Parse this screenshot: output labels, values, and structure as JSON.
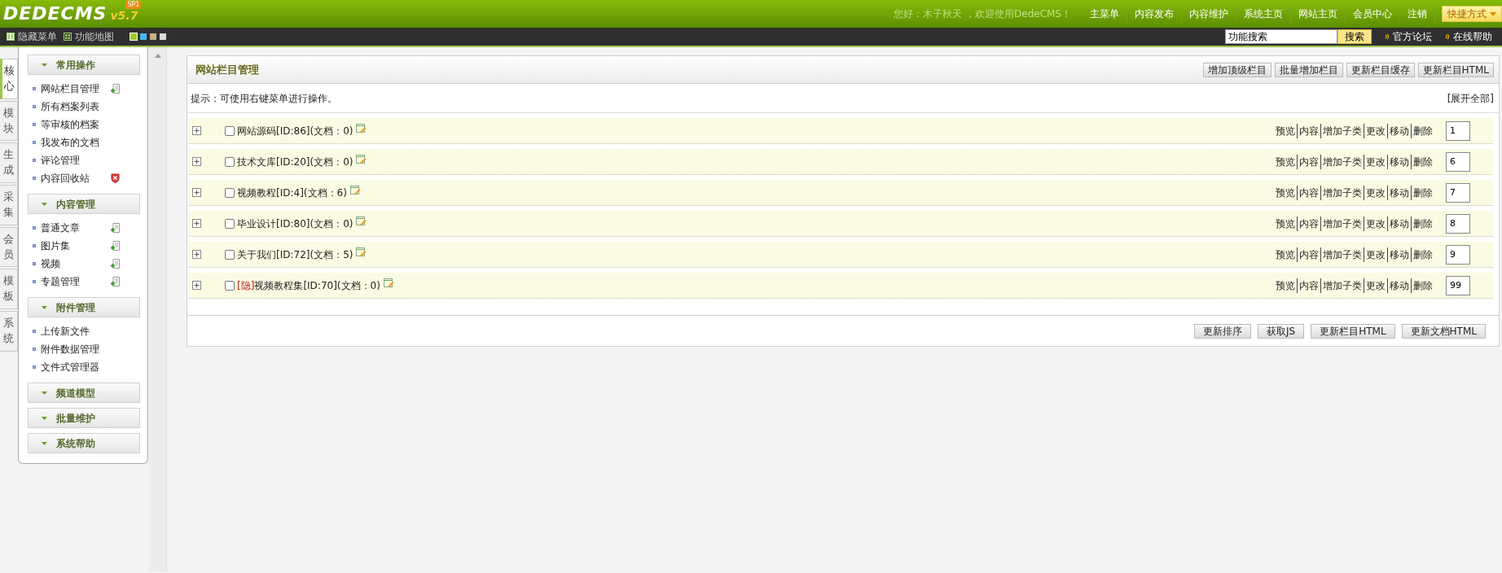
{
  "header": {
    "logo": "DEDECMS",
    "version": "v5.7",
    "badge": "SP1",
    "greeting": "您好：木子秋天 ，欢迎使用DedeCMS！",
    "nav": [
      "主菜单",
      "内容发布",
      "内容维护",
      "系统主页",
      "网站主页",
      "会员中心",
      "注销"
    ],
    "quick_menu": "快捷方式"
  },
  "toolbar": {
    "hide_menu": "隐藏菜单",
    "site_map": "功能地图",
    "themes": [
      {
        "color": "#9ccc2c",
        "selected": true
      },
      {
        "color": "#48b4e8",
        "selected": false
      },
      {
        "color": "#c4b08a",
        "selected": false
      },
      {
        "color": "#d8dadc",
        "selected": false
      }
    ],
    "search": {
      "value": "功能搜索",
      "button": "搜索"
    },
    "links": [
      "官方论坛",
      "在线帮助"
    ]
  },
  "side_tabs": [
    {
      "label": "核心",
      "selected": true
    },
    {
      "label": "模块",
      "selected": false
    },
    {
      "label": "生成",
      "selected": false
    },
    {
      "label": "采集",
      "selected": false
    },
    {
      "label": "会员",
      "selected": false
    },
    {
      "label": "模板",
      "selected": false
    },
    {
      "label": "系统",
      "selected": false
    }
  ],
  "sidebar": {
    "groups": [
      {
        "title": "常用操作",
        "items": [
          {
            "label": "网站栏目管理",
            "kind": "add"
          },
          {
            "label": "所有档案列表"
          },
          {
            "label": "等审核的档案"
          },
          {
            "label": "我发布的文档"
          },
          {
            "label": "评论管理"
          },
          {
            "label": "内容回收站",
            "kind": "remove"
          }
        ]
      },
      {
        "title": "内容管理",
        "items": [
          {
            "label": "普通文章",
            "kind": "add"
          },
          {
            "label": "图片集",
            "kind": "add"
          },
          {
            "label": "视频",
            "kind": "add"
          },
          {
            "label": "专题管理",
            "kind": "add"
          }
        ]
      },
      {
        "title": "附件管理",
        "items": [
          {
            "label": "上传新文件"
          },
          {
            "label": "附件数据管理"
          },
          {
            "label": "文件式管理器"
          }
        ]
      },
      {
        "title": "频道模型"
      },
      {
        "title": "批量维护"
      },
      {
        "title": "系统帮助"
      }
    ]
  },
  "panel": {
    "title": "网站栏目管理",
    "buttons": [
      "增加顶级栏目",
      "批量增加栏目",
      "更新栏目缓存",
      "更新栏目HTML"
    ],
    "hint": "提示：可使用右键菜单进行操作。",
    "expand_all": "[展开全部]",
    "rows": [
      {
        "expanded": false,
        "checked": false,
        "name": "网站源码[ID:86](文档：0)",
        "actions": [
          "预览",
          "内容",
          "增加子类",
          "更改",
          "移动",
          "删除"
        ],
        "order": "1"
      },
      {
        "expanded": false,
        "checked": false,
        "name": "技术文库[ID:20](文档：0)",
        "actions": [
          "预览",
          "内容",
          "增加子类",
          "更改",
          "移动",
          "删除"
        ],
        "order": "6"
      },
      {
        "expanded": false,
        "checked": false,
        "name": "视频教程[ID:4](文档：6)",
        "actions": [
          "预览",
          "内容",
          "增加子类",
          "更改",
          "移动",
          "删除"
        ],
        "order": "7"
      },
      {
        "expanded": false,
        "checked": false,
        "name": "毕业设计[ID:80](文档：0)",
        "actions": [
          "预览",
          "内容",
          "增加子类",
          "更改",
          "移动",
          "删除"
        ],
        "order": "8"
      },
      {
        "expanded": false,
        "checked": false,
        "name": "关于我们[ID:72](文档：5)",
        "actions": [
          "预览",
          "内容",
          "增加子类",
          "更改",
          "移动",
          "删除"
        ],
        "order": "9"
      },
      {
        "expanded": false,
        "checked": false,
        "tag": "[隐]",
        "name": "视频教程集[ID:70](文档：0)",
        "actions": [
          "预览",
          "内容",
          "增加子类",
          "更改",
          "移动",
          "删除"
        ],
        "order": "99"
      }
    ],
    "footer_buttons": [
      "更新排序",
      "获取JS",
      "更新栏目HTML",
      "更新文档HTML"
    ]
  }
}
